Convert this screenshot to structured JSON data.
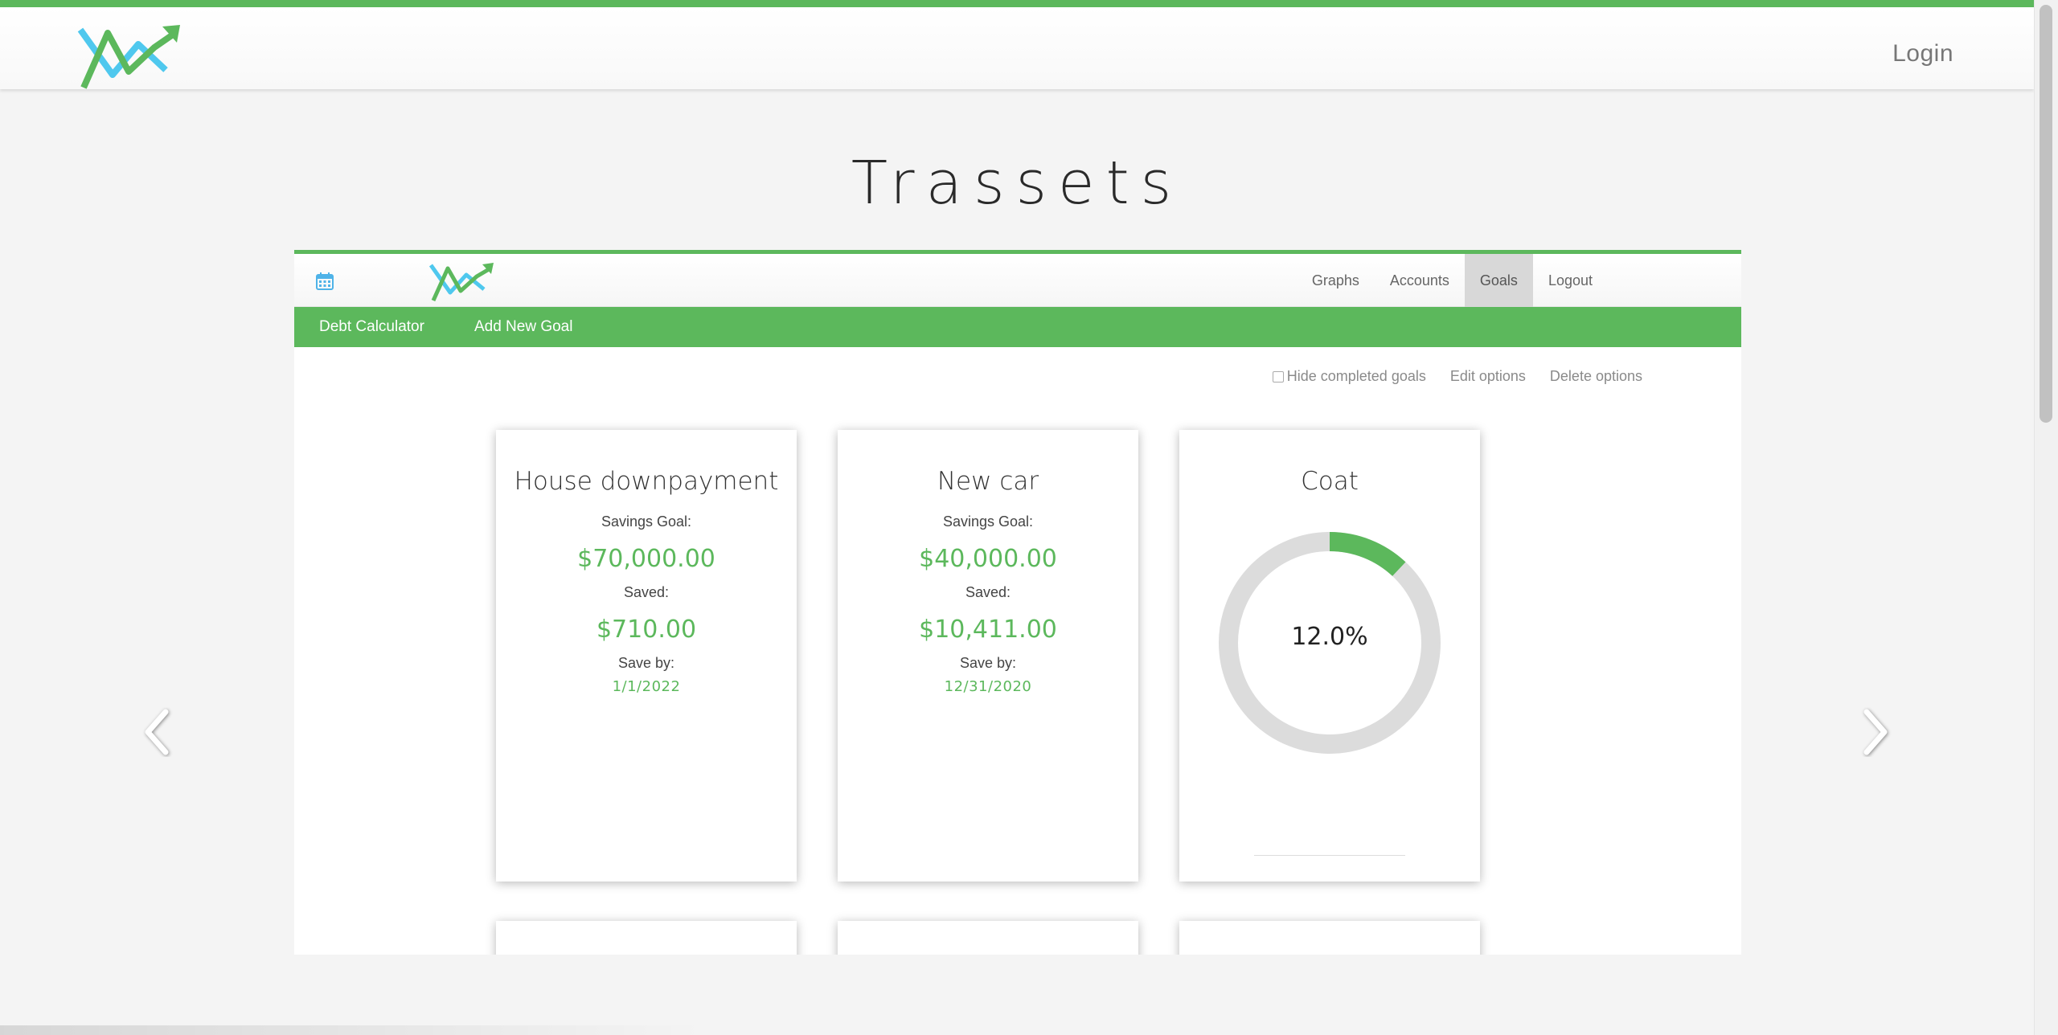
{
  "site_header": {
    "login_label": "Login"
  },
  "page": {
    "title": "Trassets"
  },
  "app_nav": {
    "menu": [
      {
        "label": "Graphs",
        "active": false
      },
      {
        "label": "Accounts",
        "active": false
      },
      {
        "label": "Goals",
        "active": true
      },
      {
        "label": "Logout",
        "active": false
      }
    ]
  },
  "sub_nav": {
    "items": [
      "Debt Calculator",
      "Add New Goal"
    ]
  },
  "options": {
    "hide_completed_label": "Hide completed goals",
    "hide_completed_checked": false,
    "edit_label": "Edit options",
    "delete_label": "Delete options"
  },
  "goals": [
    {
      "title": "House downpayment",
      "savings_goal_label": "Savings Goal:",
      "savings_goal": "$70,000.00",
      "saved_label": "Saved:",
      "saved": "$710.00",
      "save_by_label": "Save by:",
      "save_by": "1/1/2022"
    },
    {
      "title": "New car",
      "savings_goal_label": "Savings Goal:",
      "savings_goal": "$40,000.00",
      "saved_label": "Saved:",
      "saved": "$10,411.00",
      "save_by_label": "Save by:",
      "save_by": "12/31/2020"
    },
    {
      "title": "Coat",
      "progress_label": "12.0%",
      "progress": 0.12
    }
  ],
  "colors": {
    "accent": "#5cb85c",
    "logo_blue": "#4fc8ee",
    "donut_track": "#dcdcdc"
  },
  "icons": {
    "calendar": "calendar-icon",
    "prev": "chevron-left-icon",
    "next": "chevron-right-icon"
  }
}
